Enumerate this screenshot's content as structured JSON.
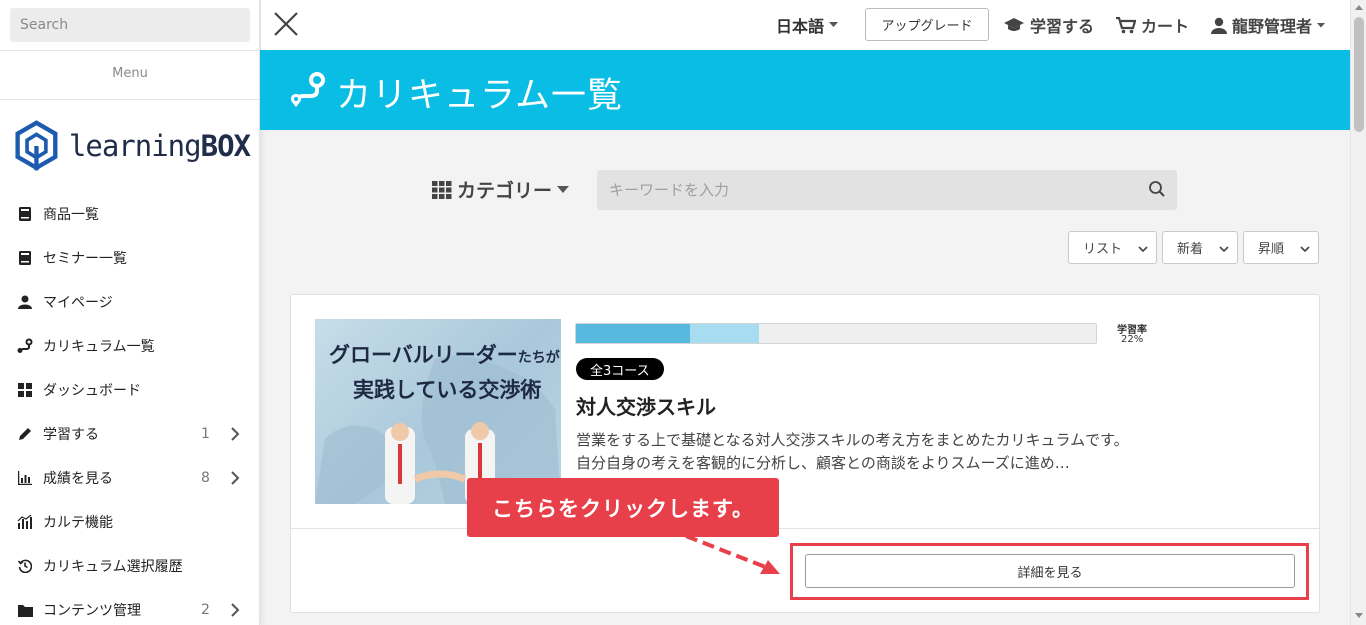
{
  "sidebar": {
    "search_placeholder": "Search",
    "menu_label": "Menu",
    "logo": {
      "text_light": "learning",
      "text_bold": "BOX"
    },
    "items": [
      {
        "label": "商品一覧",
        "icon": "book-icon"
      },
      {
        "label": "セミナー一覧",
        "icon": "book-icon"
      },
      {
        "label": "マイページ",
        "icon": "user-icon"
      },
      {
        "label": "カリキュラム一覧",
        "icon": "curriculum-icon"
      },
      {
        "label": "ダッシュボード",
        "icon": "dashboard-icon"
      },
      {
        "label": "学習する",
        "icon": "pencil-icon",
        "count": "1"
      },
      {
        "label": "成績を見る",
        "icon": "chart-icon",
        "count": "8"
      },
      {
        "label": "カルテ機能",
        "icon": "bars-icon"
      },
      {
        "label": "カリキュラム選択履歴",
        "icon": "history-icon"
      },
      {
        "label": "コンテンツ管理",
        "icon": "folder-icon",
        "count": "2"
      }
    ]
  },
  "topbar": {
    "language": "日本語",
    "upgrade": "アップグレード",
    "learn": "学習する",
    "cart": "カート",
    "user": "龍野管理者"
  },
  "banner": {
    "title": "カリキュラム一覧"
  },
  "filters": {
    "category": "カテゴリー",
    "keyword_placeholder": "キーワードを入力",
    "view": "リスト",
    "sort": "新着",
    "order": "昇順"
  },
  "card": {
    "thumbnail_line1": "グローバルリーダー",
    "thumbnail_line1_small": "たちが",
    "thumbnail_line2": "実践している交渉術",
    "progress_fraction": 0.22,
    "progress_label": "学習率",
    "progress_value": "22%",
    "badge": "全3コース",
    "title": "対人交渉スキル",
    "description": "営業をする上で基礎となる対人交渉スキルの考え方をまとめたカリキュラムです。自分自身の考えを客観的に分析し、顧客との商談をよりスムーズに進め…",
    "detail_button": "詳細を見る"
  },
  "annotation": {
    "callout": "こちらをクリックします。"
  },
  "colors": {
    "banner": "#09bde4",
    "accent_red": "#e8404a",
    "progress_dark": "#57b9dd",
    "progress_light": "#a8dcf0"
  }
}
